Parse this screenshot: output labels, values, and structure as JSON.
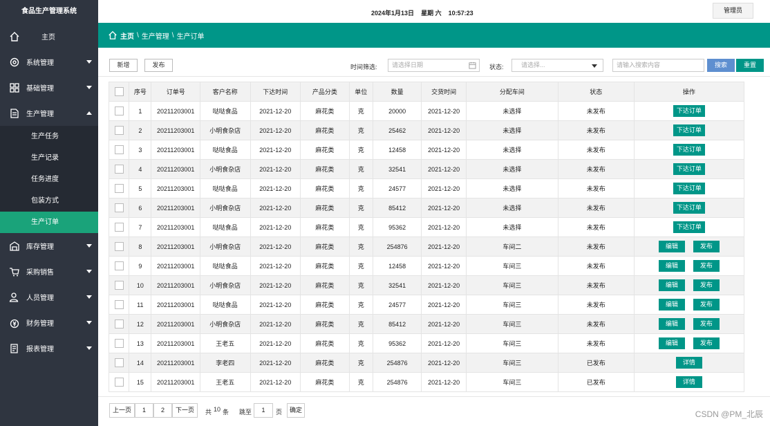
{
  "app": {
    "title": "食品生产管理系统"
  },
  "header": {
    "date": "2024年1月13日",
    "weekday": "星期 六",
    "time": "10:57:23",
    "user": "管理员"
  },
  "breadcrumb": {
    "home": "主页",
    "sep1": "\\",
    "level1": "生产管理",
    "sep2": "\\",
    "level2": "生产订单"
  },
  "sidebar": {
    "home": "主页",
    "items": [
      {
        "label": "系统管理",
        "icon": "gear-icon"
      },
      {
        "label": "基础管理",
        "icon": "grid-icon"
      },
      {
        "label": "生产管理",
        "icon": "document-icon",
        "expanded": true
      },
      {
        "label": "库存管理",
        "icon": "warehouse-icon"
      },
      {
        "label": "采购销售",
        "icon": "cart-icon"
      },
      {
        "label": "人员管理",
        "icon": "user-icon"
      },
      {
        "label": "财务管理",
        "icon": "money-icon"
      },
      {
        "label": "报表管理",
        "icon": "report-icon"
      }
    ],
    "sub": [
      "生产任务",
      "生产记录",
      "任务进度",
      "包装方式",
      "生产订单"
    ],
    "active_sub": "生产订单"
  },
  "toolbar": {
    "add": "新增",
    "publish": "发布",
    "time_filter_label": "时间筛选:",
    "date_placeholder": "请选择日期",
    "status_label": "状态:",
    "status_placeholder": "请选择...",
    "search_placeholder": "请输入搜索内容",
    "search": "搜索",
    "reset": "重置"
  },
  "table": {
    "headers": [
      "",
      "序号",
      "订单号",
      "客户名称",
      "下达时间",
      "产品分类",
      "单位",
      "数量",
      "交货时间",
      "分配车间",
      "状态",
      "操作"
    ],
    "rows": [
      {
        "no": "1",
        "order": "20211203001",
        "customer": "哒哒食品",
        "issued": "2021-12-20",
        "category": "麻花类",
        "unit": "克",
        "qty": "20000",
        "delivery": "2021-12-20",
        "workshop": "未选择",
        "status": "未发布",
        "actions": [
          "下达订单"
        ]
      },
      {
        "no": "2",
        "order": "20211203001",
        "customer": "小明食杂店",
        "issued": "2021-12-20",
        "category": "麻花类",
        "unit": "克",
        "qty": "25462",
        "delivery": "2021-12-20",
        "workshop": "未选择",
        "status": "未发布",
        "actions": [
          "下达订单"
        ]
      },
      {
        "no": "3",
        "order": "20211203001",
        "customer": "哒哒食品",
        "issued": "2021-12-20",
        "category": "麻花类",
        "unit": "克",
        "qty": "12458",
        "delivery": "2021-12-20",
        "workshop": "未选择",
        "status": "未发布",
        "actions": [
          "下达订单"
        ]
      },
      {
        "no": "4",
        "order": "20211203001",
        "customer": "小明食杂店",
        "issued": "2021-12-20",
        "category": "麻花类",
        "unit": "克",
        "qty": "32541",
        "delivery": "2021-12-20",
        "workshop": "未选择",
        "status": "未发布",
        "actions": [
          "下达订单"
        ]
      },
      {
        "no": "5",
        "order": "20211203001",
        "customer": "哒哒食品",
        "issued": "2021-12-20",
        "category": "麻花类",
        "unit": "克",
        "qty": "24577",
        "delivery": "2021-12-20",
        "workshop": "未选择",
        "status": "未发布",
        "actions": [
          "下达订单"
        ]
      },
      {
        "no": "6",
        "order": "20211203001",
        "customer": "小明食杂店",
        "issued": "2021-12-20",
        "category": "麻花类",
        "unit": "克",
        "qty": "85412",
        "delivery": "2021-12-20",
        "workshop": "未选择",
        "status": "未发布",
        "actions": [
          "下达订单"
        ]
      },
      {
        "no": "7",
        "order": "20211203001",
        "customer": "哒哒食品",
        "issued": "2021-12-20",
        "category": "麻花类",
        "unit": "克",
        "qty": "95362",
        "delivery": "2021-12-20",
        "workshop": "未选择",
        "status": "未发布",
        "actions": [
          "下达订单"
        ]
      },
      {
        "no": "8",
        "order": "20211203001",
        "customer": "小明食杂店",
        "issued": "2021-12-20",
        "category": "麻花类",
        "unit": "克",
        "qty": "254876",
        "delivery": "2021-12-20",
        "workshop": "车间二",
        "status": "未发布",
        "actions": [
          "编辑",
          "发布"
        ]
      },
      {
        "no": "9",
        "order": "20211203001",
        "customer": "哒哒食品",
        "issued": "2021-12-20",
        "category": "麻花类",
        "unit": "克",
        "qty": "12458",
        "delivery": "2021-12-20",
        "workshop": "车间三",
        "status": "未发布",
        "actions": [
          "编辑",
          "发布"
        ]
      },
      {
        "no": "10",
        "order": "20211203001",
        "customer": "小明食杂店",
        "issued": "2021-12-20",
        "category": "麻花类",
        "unit": "克",
        "qty": "32541",
        "delivery": "2021-12-20",
        "workshop": "车间三",
        "status": "未发布",
        "actions": [
          "编辑",
          "发布"
        ]
      },
      {
        "no": "11",
        "order": "20211203001",
        "customer": "哒哒食品",
        "issued": "2021-12-20",
        "category": "麻花类",
        "unit": "克",
        "qty": "24577",
        "delivery": "2021-12-20",
        "workshop": "车间三",
        "status": "未发布",
        "actions": [
          "编辑",
          "发布"
        ]
      },
      {
        "no": "12",
        "order": "20211203001",
        "customer": "小明食杂店",
        "issued": "2021-12-20",
        "category": "麻花类",
        "unit": "克",
        "qty": "85412",
        "delivery": "2021-12-20",
        "workshop": "车间三",
        "status": "未发布",
        "actions": [
          "编辑",
          "发布"
        ]
      },
      {
        "no": "13",
        "order": "20211203001",
        "customer": "王老五",
        "issued": "2021-12-20",
        "category": "麻花类",
        "unit": "克",
        "qty": "95362",
        "delivery": "2021-12-20",
        "workshop": "车间三",
        "status": "未发布",
        "actions": [
          "编辑",
          "发布"
        ]
      },
      {
        "no": "14",
        "order": "20211203001",
        "customer": "李老四",
        "issued": "2021-12-20",
        "category": "麻花类",
        "unit": "克",
        "qty": "254876",
        "delivery": "2021-12-20",
        "workshop": "车间三",
        "status": "已发布",
        "actions": [
          "详情"
        ]
      },
      {
        "no": "15",
        "order": "20211203001",
        "customer": "王老五",
        "issued": "2021-12-20",
        "category": "麻花类",
        "unit": "克",
        "qty": "254876",
        "delivery": "2021-12-20",
        "workshop": "车间三",
        "status": "已发布",
        "actions": [
          "详情"
        ]
      }
    ]
  },
  "pager": {
    "prev": "上一页",
    "pages": [
      "1",
      "2"
    ],
    "next": "下一页",
    "total_prefix": "共",
    "total": "10",
    "total_suffix": "条",
    "goto": "跳至",
    "page_input": "1",
    "page_unit": "页",
    "confirm": "确定"
  },
  "watermark": "CSDN @PM_北辰",
  "colors": {
    "sidebar": "#2f3540",
    "accent": "#009688",
    "active": "#1aa37a",
    "search": "#5e8fd0"
  }
}
